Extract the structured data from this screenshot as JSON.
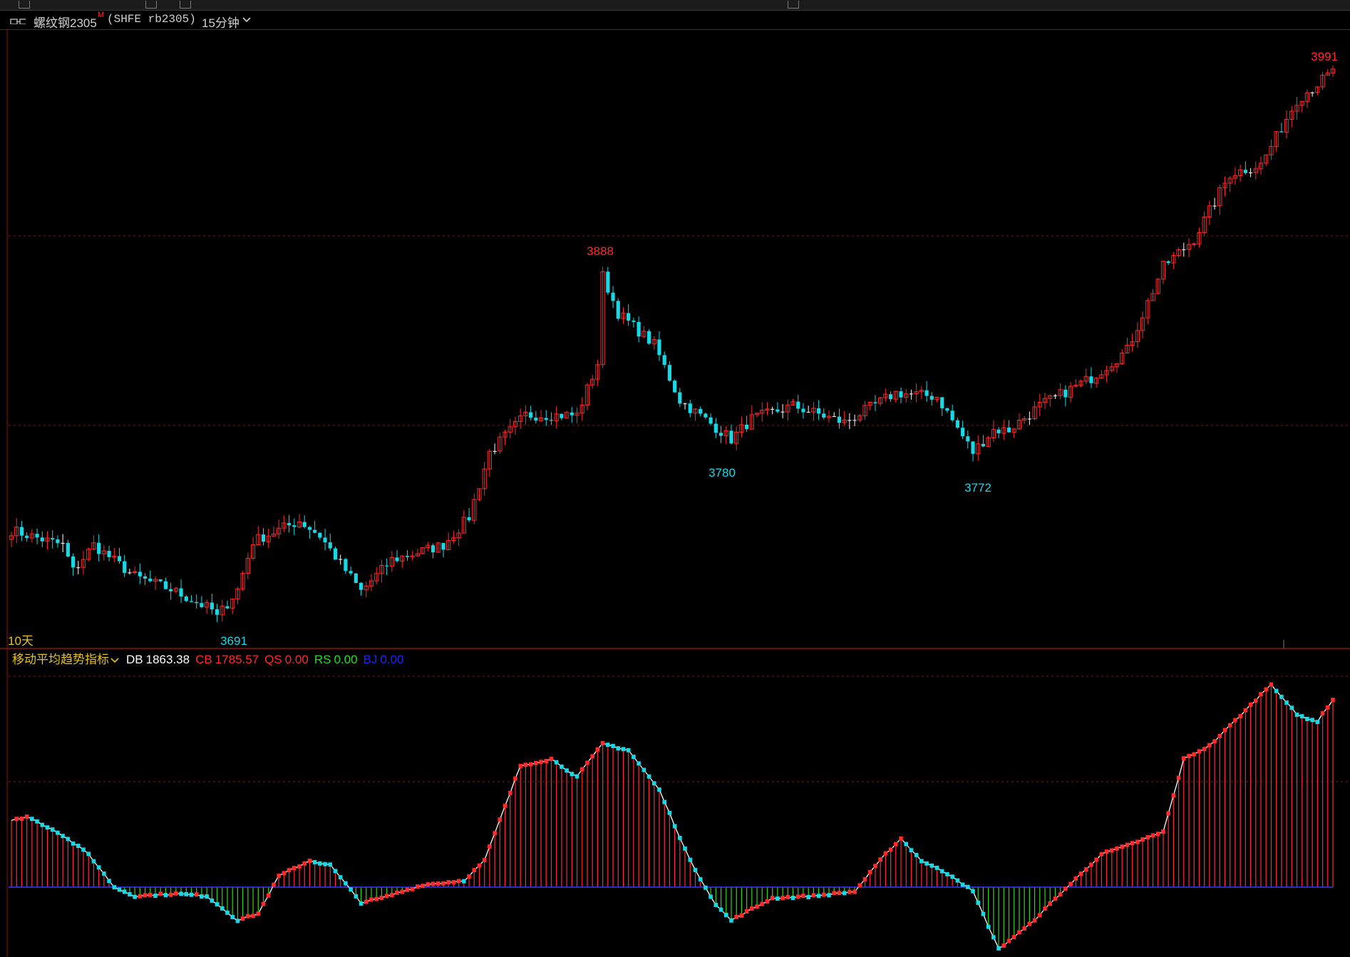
{
  "header": {
    "instrument_name": "螺纹钢2305",
    "main_marker": "M",
    "exchange_code": "(SHFE rb2305)",
    "period": "15分钟"
  },
  "colors": {
    "up": "#ff2a2a",
    "down": "#18d8e6",
    "neutral": "#ffffff",
    "grid": "#7a1818",
    "axis": "#8a1212",
    "zero_line": "#2a3cff",
    "hist_down": "#33d11a",
    "label_yellow": "#e6c21a",
    "legend_db": "#ffffff",
    "legend_cb": "#ff2a2a",
    "legend_qs": "#ff2a2a",
    "legend_rs": "#1fe01f",
    "legend_bj": "#1a28ff"
  },
  "main_chart": {
    "range_label": "10天",
    "high_label": "3991",
    "peak_label": "3888",
    "low_labels": [
      "3691",
      "3780",
      "3772"
    ]
  },
  "indicator": {
    "name": "移动平均趋势指标",
    "db_label": "DB",
    "db_value": "1863.38",
    "cb_label": "CB",
    "cb_value": "1785.57",
    "qs_label": "QS",
    "qs_value": "0.00",
    "rs_label": "RS",
    "rs_value": "0.00",
    "bj_label": "BJ",
    "bj_value": "0.00"
  },
  "chart_data": [
    {
      "type": "candlestick",
      "title": "螺纹钢2305 (SHFE rb2305) 15分钟",
      "x_label": "",
      "y_label": "",
      "ylim": [
        3680,
        3995
      ],
      "grid": true,
      "annotations": [
        {
          "text": "3691",
          "kind": "low"
        },
        {
          "text": "3888",
          "kind": "high"
        },
        {
          "text": "3780",
          "kind": "low"
        },
        {
          "text": "3772",
          "kind": "low"
        },
        {
          "text": "3991",
          "kind": "high"
        }
      ],
      "keyframes": [
        [
          0,
          3738
        ],
        [
          6,
          3733
        ],
        [
          10,
          3730
        ],
        [
          12,
          3716
        ],
        [
          16,
          3730
        ],
        [
          24,
          3713
        ],
        [
          31,
          3706
        ],
        [
          39,
          3695
        ],
        [
          40,
          3691
        ],
        [
          44,
          3706
        ],
        [
          47,
          3732
        ],
        [
          56,
          3743
        ],
        [
          60,
          3735
        ],
        [
          68,
          3705
        ],
        [
          74,
          3722
        ],
        [
          84,
          3730
        ],
        [
          89,
          3745
        ],
        [
          93,
          3780
        ],
        [
          100,
          3800
        ],
        [
          110,
          3800
        ],
        [
          114,
          3828
        ],
        [
          115,
          3875
        ],
        [
          118,
          3855
        ],
        [
          125,
          3838
        ],
        [
          130,
          3808
        ],
        [
          140,
          3787
        ],
        [
          144,
          3798
        ],
        [
          152,
          3805
        ],
        [
          162,
          3796
        ],
        [
          172,
          3812
        ],
        [
          180,
          3810
        ],
        [
          187,
          3780
        ],
        [
          191,
          3792
        ],
        [
          194,
          3792
        ],
        [
          200,
          3805
        ],
        [
          210,
          3820
        ],
        [
          217,
          3835
        ],
        [
          224,
          3880
        ],
        [
          230,
          3895
        ],
        [
          237,
          3930
        ],
        [
          243,
          3935
        ],
        [
          250,
          3970
        ],
        [
          257,
          3985
        ]
      ],
      "n_candles": 258
    },
    {
      "type": "bar",
      "title": "移动平均趋势指标",
      "series": [
        {
          "name": "DB",
          "last_value": 1863.38
        },
        {
          "name": "CB",
          "last_value": 1785.57
        },
        {
          "name": "QS",
          "last_value": 0.0
        },
        {
          "name": "RS",
          "last_value": 0.0
        },
        {
          "name": "BJ",
          "last_value": 0.0
        }
      ],
      "keyframes": [
        [
          0,
          0.3
        ],
        [
          3,
          0.32
        ],
        [
          9,
          0.25
        ],
        [
          15,
          0.15
        ],
        [
          20,
          0.0
        ],
        [
          24,
          -0.04
        ],
        [
          32,
          -0.03
        ],
        [
          38,
          -0.04
        ],
        [
          44,
          -0.15
        ],
        [
          48,
          -0.12
        ],
        [
          52,
          0.05
        ],
        [
          58,
          0.12
        ],
        [
          62,
          0.1
        ],
        [
          68,
          -0.07
        ],
        [
          72,
          -0.05
        ],
        [
          80,
          0.01
        ],
        [
          88,
          0.03
        ],
        [
          92,
          0.12
        ],
        [
          99,
          0.55
        ],
        [
          105,
          0.58
        ],
        [
          110,
          0.5
        ],
        [
          115,
          0.65
        ],
        [
          120,
          0.62
        ],
        [
          126,
          0.44
        ],
        [
          132,
          0.12
        ],
        [
          137,
          -0.08
        ],
        [
          140,
          -0.15
        ],
        [
          148,
          -0.05
        ],
        [
          156,
          -0.04
        ],
        [
          164,
          -0.02
        ],
        [
          170,
          0.15
        ],
        [
          173,
          0.22
        ],
        [
          177,
          0.12
        ],
        [
          183,
          0.05
        ],
        [
          187,
          -0.02
        ],
        [
          192,
          -0.28
        ],
        [
          198,
          -0.17
        ],
        [
          204,
          -0.03
        ],
        [
          208,
          0.06
        ],
        [
          212,
          0.15
        ],
        [
          216,
          0.18
        ],
        [
          224,
          0.25
        ],
        [
          228,
          0.58
        ],
        [
          233,
          0.64
        ],
        [
          240,
          0.8
        ],
        [
          245,
          0.92
        ],
        [
          250,
          0.78
        ],
        [
          254,
          0.75
        ],
        [
          257,
          0.85
        ]
      ],
      "n_bars": 258
    }
  ]
}
